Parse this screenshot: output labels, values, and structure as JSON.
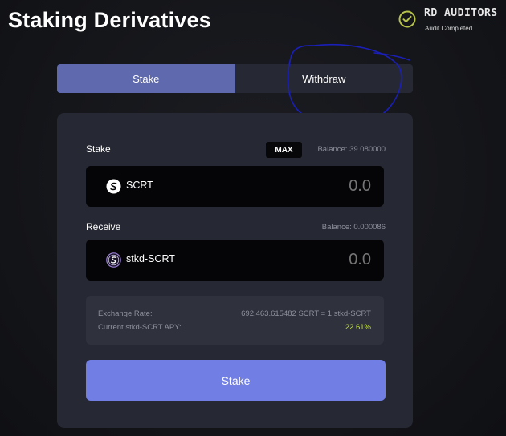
{
  "page": {
    "title": "Staking Derivatives"
  },
  "audit": {
    "name": "RD AUDITORS",
    "status": "Audit Completed",
    "accent_color": "#b7c24a"
  },
  "tabs": [
    {
      "label": "Stake",
      "active": true
    },
    {
      "label": "Withdraw",
      "active": false
    }
  ],
  "stake_section": {
    "label": "Stake",
    "max_label": "MAX",
    "balance": "Balance: 39.080000",
    "token": {
      "name": "SCRT",
      "icon": "scrt-icon"
    },
    "amount_placeholder": "0.0"
  },
  "receive_section": {
    "label": "Receive",
    "balance": "Balance: 0.000086",
    "token": {
      "name": "stkd-SCRT",
      "icon": "stkd-scrt-icon"
    },
    "amount_placeholder": "0.0"
  },
  "rate_info": {
    "exchange_rate_label": "Exchange Rate:",
    "exchange_rate_value": "692,463.615482 SCRT = 1 stkd-SCRT",
    "apy_label": "Current stkd-SCRT APY:",
    "apy_value": "22.61%",
    "apy_color": "#c2e33a"
  },
  "submit": {
    "label": "Stake",
    "color": "#717ee3"
  },
  "colors": {
    "active_tab": "#5f69ad",
    "card": "#262833",
    "input_box": "#050507",
    "annotation_stroke": "#1a1fb8"
  }
}
